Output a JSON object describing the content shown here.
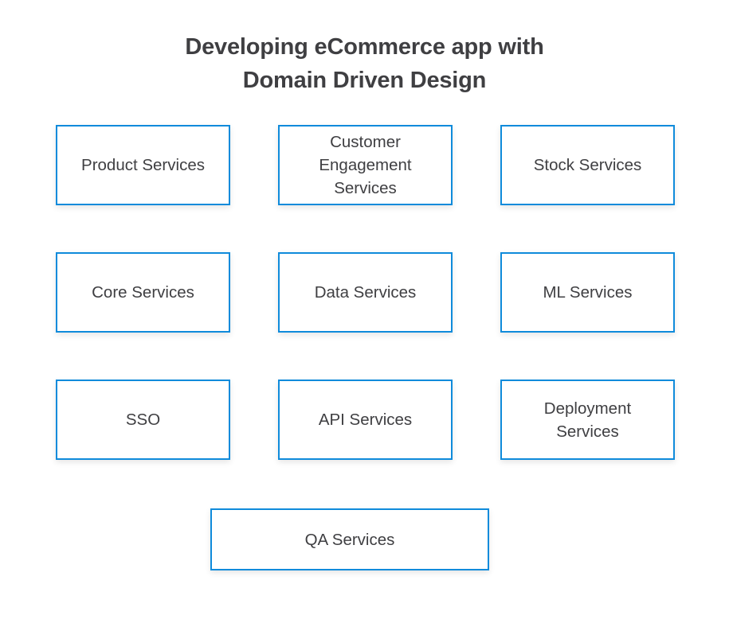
{
  "title": {
    "line1": "Developing eCommerce app with",
    "line2": "Domain Driven Design"
  },
  "colors": {
    "box_border": "#0f8bdb",
    "box_fill": "#ffffff",
    "text": "#3f3f42",
    "page_background": "#ffffff"
  },
  "boxes": [
    {
      "id": "product-services",
      "label": "Product Services",
      "row": 1,
      "col": 1
    },
    {
      "id": "customer-engagement-services",
      "label": "Customer\nEngagement\nServices",
      "row": 1,
      "col": 2
    },
    {
      "id": "stock-services",
      "label": "Stock Services",
      "row": 1,
      "col": 3
    },
    {
      "id": "core-services",
      "label": "Core Services",
      "row": 2,
      "col": 1
    },
    {
      "id": "data-services",
      "label": "Data Services",
      "row": 2,
      "col": 2
    },
    {
      "id": "ml-services",
      "label": "ML Services",
      "row": 2,
      "col": 3
    },
    {
      "id": "sso",
      "label": "SSO",
      "row": 3,
      "col": 1
    },
    {
      "id": "api-services",
      "label": "API Services",
      "row": 3,
      "col": 2
    },
    {
      "id": "deployment-services",
      "label": "Deployment\nServices",
      "row": 3,
      "col": 3
    },
    {
      "id": "qa-services",
      "label": "QA Services",
      "row": 4,
      "col": "wide"
    }
  ]
}
